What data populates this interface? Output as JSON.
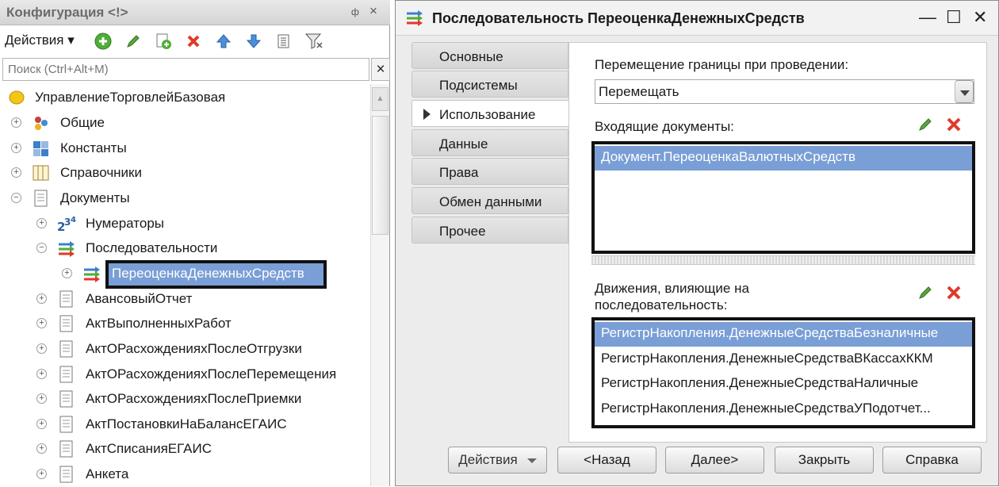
{
  "left_panel": {
    "title": "Конфигурация <!>",
    "pin_label": "ф",
    "close_label": "×",
    "actions_label": "Действия ▾",
    "search_placeholder": "Поиск (Ctrl+Alt+M)",
    "search_clear": "×",
    "tree": [
      {
        "label": "УправлениеТорговлейБазовая",
        "icon": "config-root-icon"
      },
      {
        "label": "Общие",
        "icon": "common-icon",
        "expander": "+"
      },
      {
        "label": "Константы",
        "icon": "constants-icon",
        "expander": "+"
      },
      {
        "label": "Справочники",
        "icon": "catalogs-icon",
        "expander": "+"
      },
      {
        "label": "Документы",
        "icon": "documents-icon",
        "expander": "−"
      },
      {
        "label": "Нумераторы",
        "icon": "numerators-icon",
        "expander": "+"
      },
      {
        "label": "Последовательности",
        "icon": "sequences-icon",
        "expander": "−"
      },
      {
        "label": "ПереоценкаДенежныхСредств",
        "icon": "sequence-icon",
        "expander": "+",
        "selected": true
      },
      {
        "label": "АвансовыйОтчет",
        "icon": "document-icon",
        "expander": "+"
      },
      {
        "label": "АктВыполненныхРабот",
        "icon": "document-icon",
        "expander": "+"
      },
      {
        "label": "АктОРасхожденияхПослеОтгрузки",
        "icon": "document-icon",
        "expander": "+"
      },
      {
        "label": "АктОРасхожденияхПослеПеремещения",
        "icon": "document-icon",
        "expander": "+"
      },
      {
        "label": "АктОРасхожденияхПослеПриемки",
        "icon": "document-icon",
        "expander": "+"
      },
      {
        "label": "АктПостановкиНаБалансЕГАИС",
        "icon": "document-icon",
        "expander": "+"
      },
      {
        "label": "АктСписанияЕГАИС",
        "icon": "document-icon",
        "expander": "+"
      },
      {
        "label": "Анкета",
        "icon": "document-icon",
        "expander": "+"
      }
    ]
  },
  "window": {
    "title": "Последовательность ПереоценкаДенежныхСредств",
    "minimize": "—",
    "maximize": "☐",
    "close": "✕",
    "tabs": [
      {
        "label": "Основные"
      },
      {
        "label": "Подсистемы"
      },
      {
        "label": "Использование",
        "active": true
      },
      {
        "label": "Данные"
      },
      {
        "label": "Права"
      },
      {
        "label": "Обмен данными"
      },
      {
        "label": "Прочее"
      }
    ],
    "move_boundary_label": "Перемещение границы при проведении:",
    "move_boundary_value": "Перемещать",
    "incoming_docs_label": "Входящие  документы:",
    "incoming_docs": [
      "Документ.ПереоценкаВалютныхСредств"
    ],
    "movements_label_line1": "Движения, влияющие на",
    "movements_label_line2": "последовательность:",
    "movements": [
      "РегистрНакопления.ДенежныеСредстваБезналичные",
      "РегистрНакопления.ДенежныеСредстваВКассахККМ",
      "РегистрНакопления.ДенежныеСредстваНаличные",
      "РегистрНакопления.ДенежныеСредстваУПодотчет..."
    ],
    "buttons": {
      "actions": "Действия",
      "back": "<Назад",
      "next": "Далее>",
      "close": "Закрыть",
      "help": "Справка"
    }
  },
  "colors": {
    "selection": "#7a9ed6",
    "highlight_border": "#111111",
    "delete_red": "#e03a2a",
    "edit_green": "#3a9a2a"
  }
}
